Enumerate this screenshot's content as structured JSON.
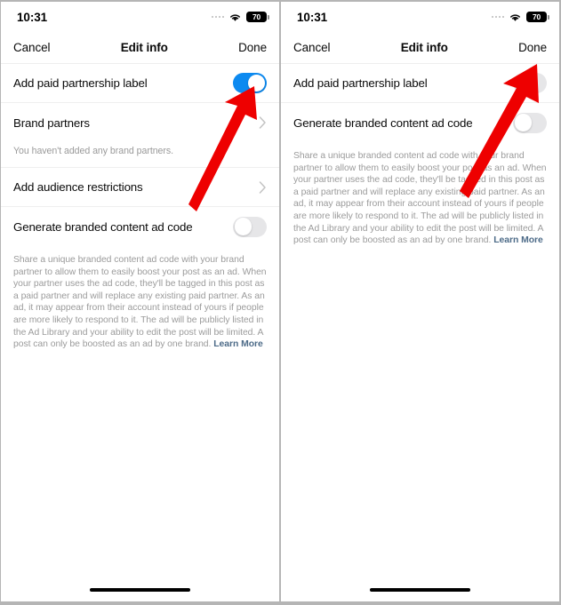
{
  "status_bar": {
    "time": "10:31",
    "wifi_icon": "wifi-icon",
    "battery_level": "70",
    "signal_dots_icon": "signal-dots-icon"
  },
  "nav": {
    "cancel_label": "Cancel",
    "title": "Edit info",
    "done_label": "Done"
  },
  "colors": {
    "toggle_on": "#0d8af0",
    "toggle_off": "#e6e6e8",
    "annotation_arrow": "#ee0000",
    "link": "#4d6b88"
  },
  "panels": [
    {
      "name": "left-panel",
      "rows": [
        {
          "label": "Add paid partnership label",
          "control": "toggle",
          "toggle_state": "on"
        },
        {
          "label": "Brand partners",
          "control": "chevron",
          "subtext": "You haven't added any brand partners."
        },
        {
          "label": "Add audience restrictions",
          "control": "chevron"
        },
        {
          "label": "Generate branded content ad code",
          "control": "toggle",
          "toggle_state": "off"
        }
      ],
      "description": "Share a unique branded content ad code with your brand partner to allow them to easily boost your post as an ad. When your partner uses the ad code, they'll be tagged in this post as a paid partner and will replace any existing paid partner. As an ad, it may appear from their account instead of yours if people are more likely to respond to it. The ad will be publicly listed in the Ad Library and your ability to edit the post will be limited. A post can only be boosted as an ad by one brand.",
      "learn_more_label": "Learn More",
      "annotation_target": "paid-partnership-toggle"
    },
    {
      "name": "right-panel",
      "rows": [
        {
          "label": "Add paid partnership label",
          "control": "toggle",
          "toggle_state": "off"
        },
        {
          "label": "Generate branded content ad code",
          "control": "toggle",
          "toggle_state": "off"
        }
      ],
      "description": "Share a unique branded content ad code with your brand partner to allow them to easily boost your post as an ad. When your partner uses the ad code, they'll be tagged in this post as a paid partner and will replace any existing paid partner. As an ad, it may appear from their account instead of yours if people are more likely to respond to it. The ad will be publicly listed in the Ad Library and your ability to edit the post will be limited. A post can only be boosted as an ad by one brand.",
      "learn_more_label": "Learn More",
      "annotation_target": "done-button"
    }
  ]
}
